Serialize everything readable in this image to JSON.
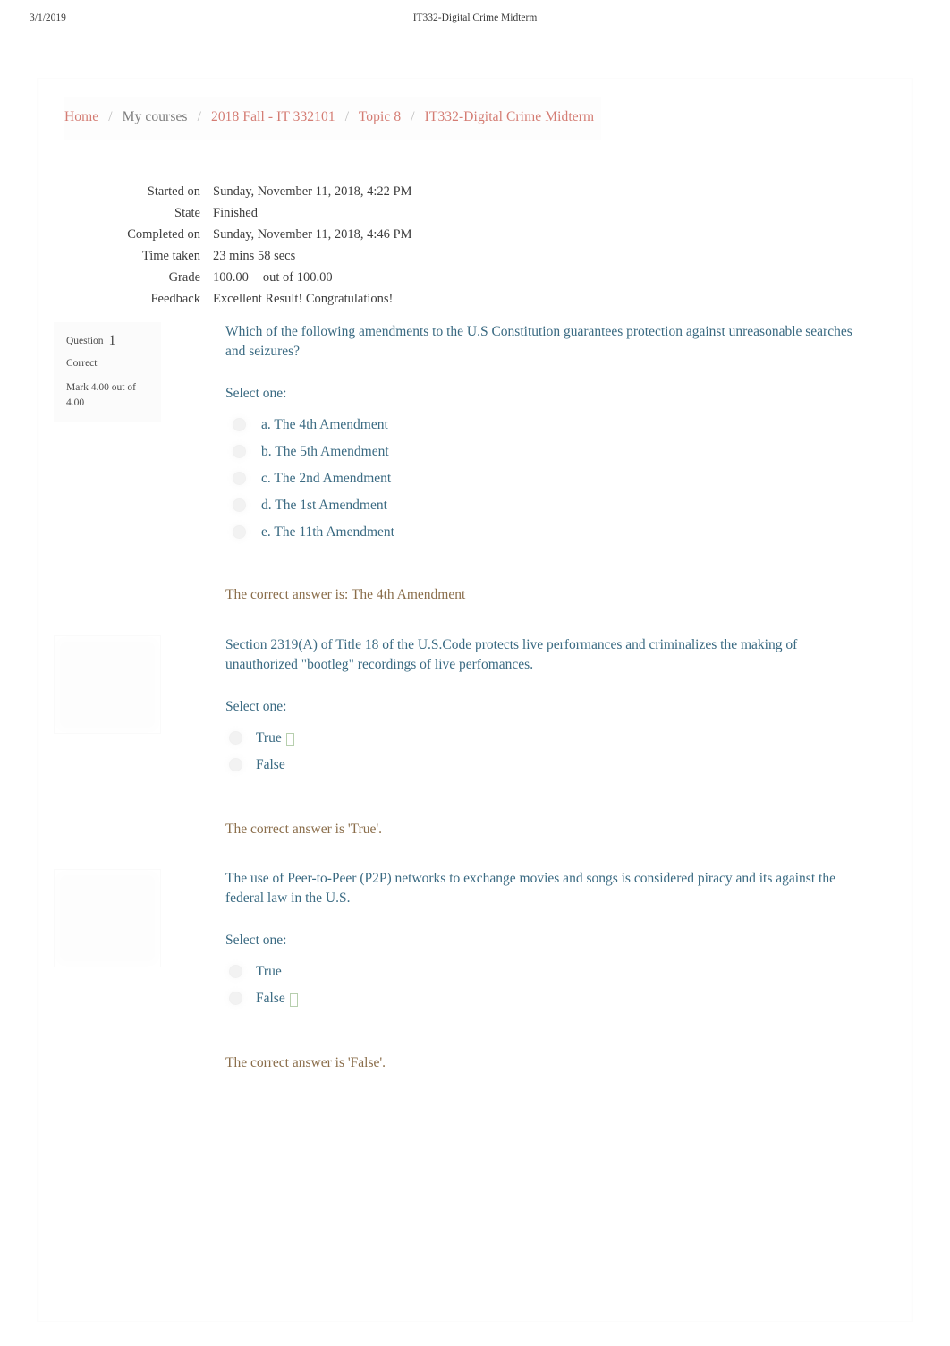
{
  "print_header": {
    "date": "3/1/2019",
    "title": "IT332-Digital Crime Midterm"
  },
  "breadcrumb": {
    "items": [
      {
        "label": "Home",
        "type": "link"
      },
      {
        "label": "My courses",
        "type": "plain"
      },
      {
        "label": "2018 Fall - IT 332101",
        "type": "link"
      },
      {
        "label": "Topic 8",
        "type": "link"
      },
      {
        "label": "IT332-Digital Crime Midterm",
        "type": "link"
      }
    ],
    "separator": "/"
  },
  "summary": {
    "rows": [
      {
        "label": "Started on",
        "value": "Sunday, November 11, 2018, 4:22 PM"
      },
      {
        "label": "State",
        "value": "Finished"
      },
      {
        "label": "Completed on",
        "value": "Sunday, November 11, 2018, 4:46 PM"
      },
      {
        "label": "Time taken",
        "value": "23 mins 58 secs"
      },
      {
        "label": "Grade",
        "value": "100.00",
        "extra": "out of 100.00"
      },
      {
        "label": "Feedback",
        "value": "Excellent Result! Congratulations!"
      }
    ]
  },
  "questions": [
    {
      "info": {
        "question_label": "Question",
        "number": "1",
        "state": "Correct",
        "grade": "Mark 4.00 out of 4.00"
      },
      "text": "Which of the following amendments to the U.S Constitution guarantees protection against unreasonable searches and seizures?",
      "prompt": "Select one:",
      "answers": [
        {
          "label": "a. The 4th Amendment",
          "selected_marker": ""
        },
        {
          "label": "b. The 5th Amendment",
          "selected_marker": ""
        },
        {
          "label": "c. The 2nd Amendment",
          "selected_marker": ""
        },
        {
          "label": "d. The 1st Amendment",
          "selected_marker": ""
        },
        {
          "label": "e. The 11th Amendment",
          "selected_marker": ""
        }
      ],
      "feedback": "The correct answer is: The 4th Amendment"
    },
    {
      "info": {
        "question_label": "",
        "number": "",
        "state": "",
        "grade": ""
      },
      "text": "Section 2319(A) of Title 18 of the U.S.Code protects live performances and criminalizes the making of unauthorized \"bootleg\" recordings of live perfomances.",
      "prompt": "Select one:",
      "answers": [
        {
          "label": "True",
          "selected_marker": " "
        },
        {
          "label": "False",
          "selected_marker": ""
        }
      ],
      "feedback": "The correct answer is 'True'."
    },
    {
      "info": {
        "question_label": "",
        "number": "",
        "state": "",
        "grade": ""
      },
      "text": "The use of Peer-to-Peer (P2P) networks to exchange movies and songs is considered piracy and its against the federal law in the U.S.",
      "prompt": "Select one:",
      "answers": [
        {
          "label": "True",
          "selected_marker": ""
        },
        {
          "label": "False",
          "selected_marker": " "
        }
      ],
      "feedback": "The correct answer is 'False'."
    }
  ],
  "colors": {
    "link": "#c0392b",
    "question_text": "#3a6a82",
    "feedback": "#8a6d4a",
    "marker": "#a8c7a0",
    "body_text": "#3d3d3d"
  }
}
